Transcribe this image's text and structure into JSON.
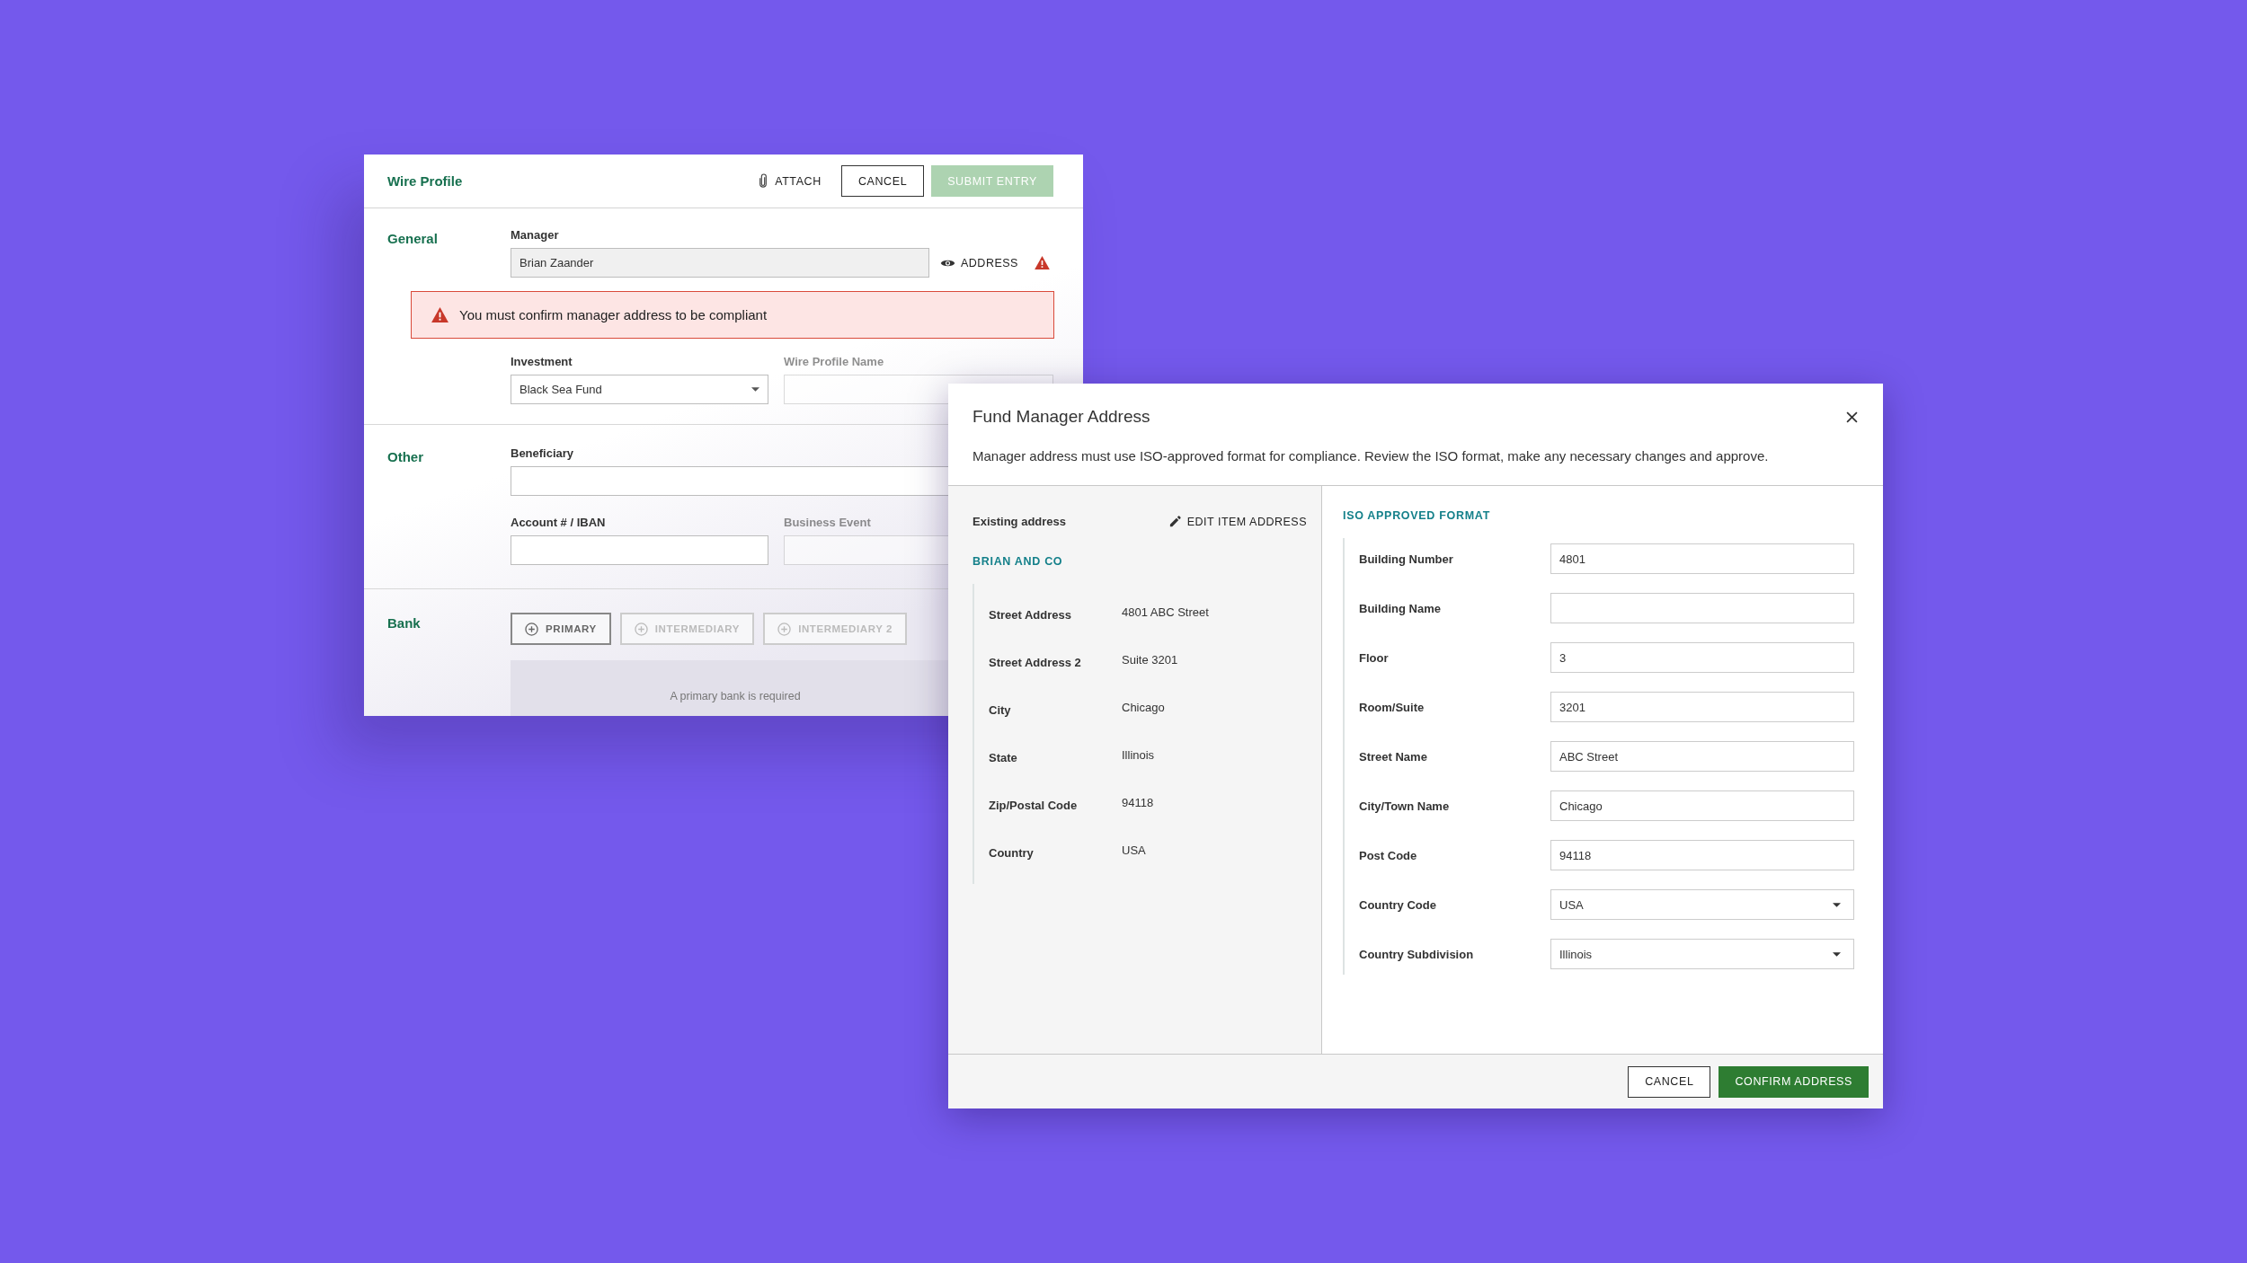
{
  "wire_profile": {
    "title": "Wire Profile",
    "actions": [
      {
        "kind": "attach",
        "label": "ATTACH",
        "disabled": false
      },
      {
        "kind": "outline",
        "label": "CANCEL",
        "disabled": false
      },
      {
        "kind": "primary",
        "label": "SUBMIT ENTRY",
        "disabled": true
      }
    ],
    "general": {
      "title": "General",
      "manager": {
        "label": "Manager",
        "value": "Brian Zaander"
      },
      "address_link": "ADDRESS",
      "alert": "You must confirm manager address to be compliant",
      "investment": {
        "label": "Investment",
        "value": "Black Sea Fund"
      },
      "wire_profile_name": {
        "label": "Wire Profile Name"
      }
    },
    "other": {
      "title": "Other",
      "beneficiary": {
        "label": "Beneficiary"
      },
      "account": {
        "label": "Account # / IBAN"
      },
      "business_event": {
        "label": "Business Event"
      }
    },
    "bank": {
      "title": "Bank",
      "tabs": [
        {
          "label": "PRIMARY",
          "selected": true
        },
        {
          "label": "INTERMEDIARY",
          "selected": false
        },
        {
          "label": "INTERMEDIARY 2",
          "selected": false
        }
      ],
      "empty_message": "A primary bank is required"
    }
  },
  "address_modal": {
    "title": "Fund Manager Address",
    "description": "Manager address must use ISO-approved format for compliance. Review the ISO format, make any necessary changes and approve.",
    "existing": {
      "heading": "Existing address",
      "edit_action": "EDIT ITEM ADDRESS",
      "name": "BRIAN AND CO",
      "rows": [
        {
          "label": "Street Address",
          "value": "4801 ABC Street"
        },
        {
          "label": "Street Address 2",
          "value": "Suite 3201"
        },
        {
          "label": "City",
          "value": "Chicago"
        },
        {
          "label": "State",
          "value": "Illinois"
        },
        {
          "label": "Zip/Postal Code",
          "value": "94118"
        },
        {
          "label": "Country",
          "value": "USA"
        }
      ]
    },
    "iso": {
      "heading": "ISO APPROVED FORMAT",
      "fields": [
        {
          "kind": "text",
          "label": "Building Number",
          "value": "4801"
        },
        {
          "kind": "text",
          "label": "Building Name"
        },
        {
          "kind": "text",
          "label": "Floor",
          "value": "3"
        },
        {
          "kind": "text",
          "label": "Room/Suite",
          "value": "3201"
        },
        {
          "kind": "text",
          "label": "Street Name",
          "value": "ABC Street"
        },
        {
          "kind": "text",
          "label": "City/Town Name",
          "value": "Chicago"
        },
        {
          "kind": "text",
          "label": "Post Code",
          "value": "94118"
        },
        {
          "kind": "select",
          "label": "Country Code",
          "value": "USA"
        },
        {
          "kind": "select",
          "label": "Country Subdivision",
          "value": "Illinois"
        }
      ]
    },
    "buttons": [
      {
        "kind": "outline",
        "label": "CANCEL"
      },
      {
        "kind": "primary",
        "label": "CONFIRM ADDRESS"
      }
    ]
  }
}
